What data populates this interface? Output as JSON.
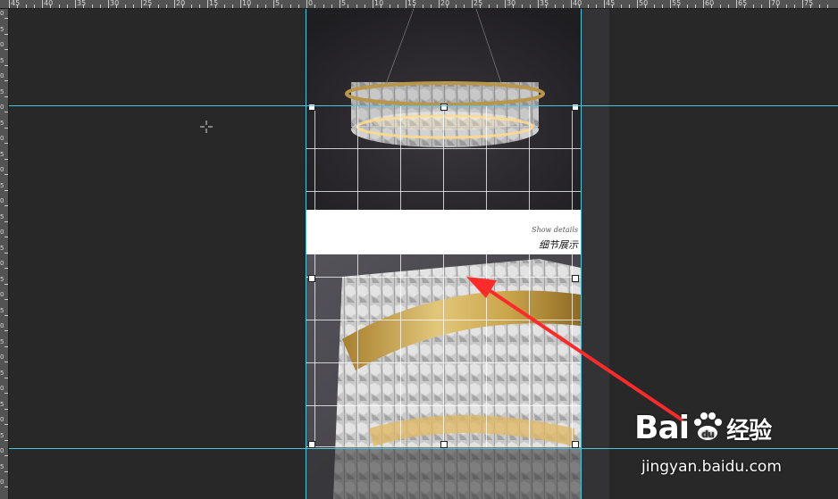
{
  "ruler_top": {
    "labels": [
      "45",
      "40",
      "35",
      "30",
      "25",
      "20",
      "15",
      "10",
      "5",
      "0",
      "5",
      "10",
      "15",
      "20",
      "25",
      "30",
      "35",
      "40",
      "45",
      "50",
      "55",
      "60",
      "65",
      "70",
      "75"
    ]
  },
  "ruler_left": {
    "labels": [
      "0",
      "5",
      "0",
      "5",
      "0",
      "5",
      "0",
      "5",
      "0",
      "5",
      "0",
      "5",
      "0",
      "5",
      "0",
      "5",
      "0",
      "5",
      "0",
      "5",
      "0",
      "5",
      "0",
      "5",
      "0",
      "5",
      "0",
      "5",
      "0",
      "5",
      "0"
    ]
  },
  "canvas": {
    "show_details": "Show details",
    "detail_cn": "细节展示"
  },
  "watermark": {
    "logo_text": "Bai",
    "logo_cn": "经验",
    "url": "jingyan.baidu.com"
  },
  "colors": {
    "guide": "#4fc3d9",
    "arrow": "#ff2a2a",
    "gold": "#c9a44a",
    "workspace": "#282828"
  }
}
